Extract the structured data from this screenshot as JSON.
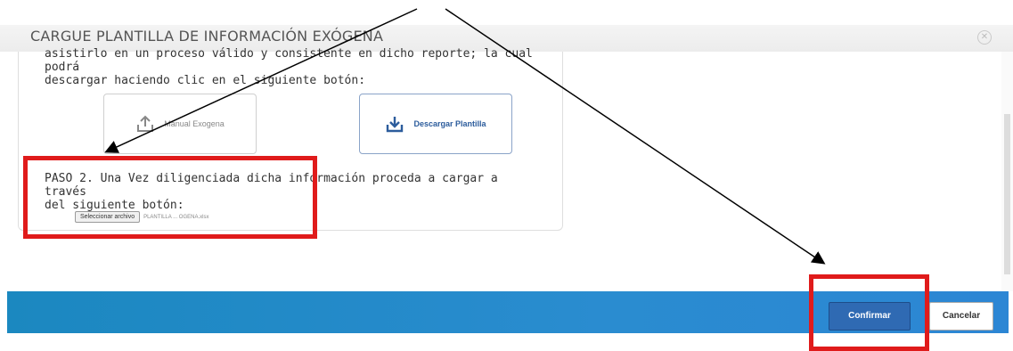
{
  "dialog": {
    "title": "CARGUE PLANTILLA DE INFORMACIÓN EXÓGENA",
    "intro_line1": "asistirlo en un proceso válido y consistente en dicho reporte; la cual podrá",
    "intro_line2": "descargar haciendo clic en el siguiente botón:"
  },
  "buttons": {
    "manual_label": "Manual Exogena",
    "descargar_label": "Descargar Plantilla",
    "manual_icon": "upload-icon",
    "descargar_icon": "download-icon"
  },
  "paso2": {
    "line1": "PASO 2. Una Vez diligenciada dicha información proceda a cargar a través",
    "line2": "del siguiente botón:",
    "file_button_label": "Seleccionar archivo",
    "file_name": "PLANTILLA ... OGENA.xlsx"
  },
  "footer": {
    "confirm_label": "Confirmar",
    "cancel_label": "Cancelar"
  },
  "colors": {
    "annotation_red": "#e01b1b",
    "footer_blue": "#1b88c0",
    "confirm_blue": "#2f6ab3"
  }
}
